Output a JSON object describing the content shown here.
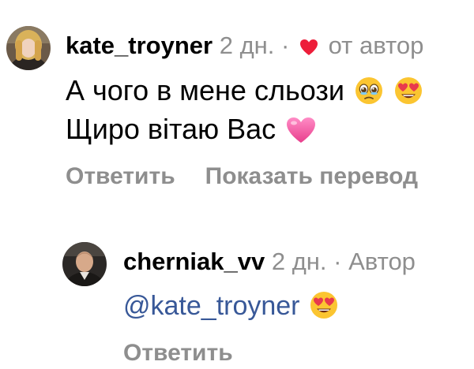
{
  "comment1": {
    "username": "kate_troyner",
    "time": "2 дн.",
    "separator": "·",
    "liked_by_author": "от автор",
    "text_line1": "А чого в мене сльози",
    "text_line2": "Щиро вітаю Вас",
    "emoji_line1": [
      "face-holding-back-tears-icon",
      "smiling-face-heart-eyes-icon"
    ],
    "emoji_line2": [
      "pink-heart-icon"
    ],
    "actions": {
      "reply": "Ответить",
      "translate": "Показать перевод"
    }
  },
  "comment2": {
    "username": "cherniak_vv",
    "time": "2 дн.",
    "separator": "·",
    "author_badge": "Автор",
    "mention": "@kate_troyner",
    "emoji": [
      "smiling-face-heart-eyes-icon"
    ],
    "actions": {
      "reply": "Ответить"
    }
  },
  "colors": {
    "text": "#000000",
    "meta": "#8e8e8e",
    "mention": "#385898",
    "heart": "#ed1e3a",
    "pink_heart": "#f25ba8"
  }
}
